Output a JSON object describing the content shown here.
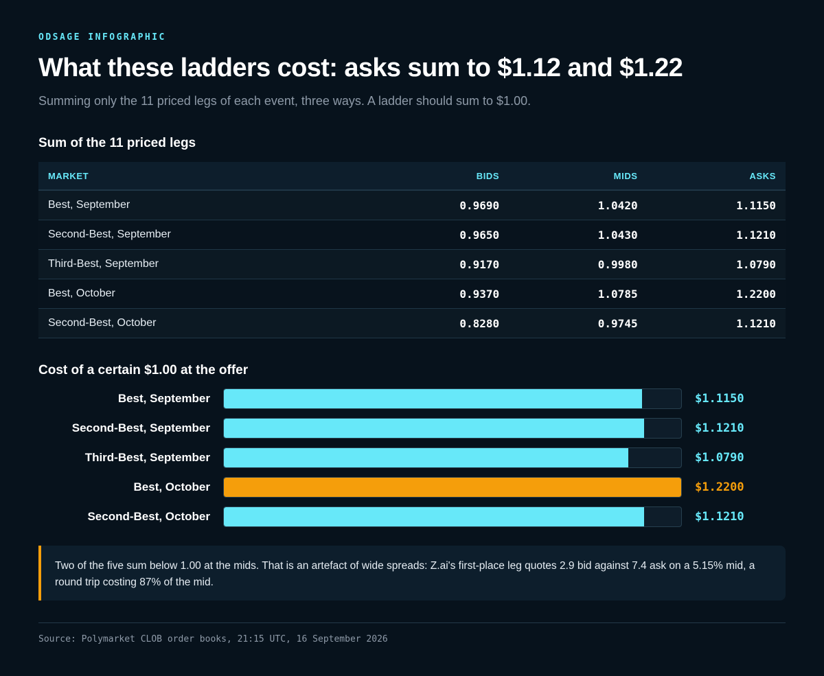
{
  "header": {
    "eyebrow": "ODSAGE INFOGRAPHIC",
    "title": "What these ladders cost: asks sum to $1.12 and $1.22",
    "subtitle": "Summing only the 11 priced legs of each event, three ways. A ladder should sum to $1.00."
  },
  "table": {
    "title": "Sum of the 11 priced legs",
    "columns": [
      "MARKET",
      "BIDS",
      "MIDS",
      "ASKS"
    ],
    "rows": [
      [
        "Best, September",
        "0.9690",
        "1.0420",
        "1.1150"
      ],
      [
        "Second-Best, September",
        "0.9650",
        "1.0430",
        "1.1210"
      ],
      [
        "Third-Best, September",
        "0.9170",
        "0.9980",
        "1.0790"
      ],
      [
        "Best, October",
        "0.9370",
        "1.0785",
        "1.2200"
      ],
      [
        "Second-Best, October",
        "0.8280",
        "0.9745",
        "1.1210"
      ]
    ]
  },
  "chart_data": {
    "type": "bar",
    "title": "Cost of a certain $1.00 at the offer",
    "orientation": "horizontal",
    "categories": [
      "Best, September",
      "Second-Best, September",
      "Third-Best, September",
      "Best, October",
      "Second-Best, October"
    ],
    "values": [
      1.115,
      1.121,
      1.079,
      1.22,
      1.121
    ],
    "value_labels": [
      "$1.1150",
      "$1.1210",
      "$1.0790",
      "$1.2200",
      "$1.1210"
    ],
    "xlim": [
      0,
      1.22
    ],
    "highlight_index": 3,
    "colors": {
      "default": "#67e8f9",
      "highlight": "#f59e0b"
    }
  },
  "note": {
    "text": "Two of the five sum below 1.00 at the mids. That is an artefact of wide spreads: Z.ai's first-place leg quotes 2.9 bid against 7.4 ask on a 5.15% mid, a round trip costing 87% of the mid."
  },
  "footer": {
    "source": "Source: Polymarket CLOB order books, 21:15 UTC, 16 September 2026"
  }
}
